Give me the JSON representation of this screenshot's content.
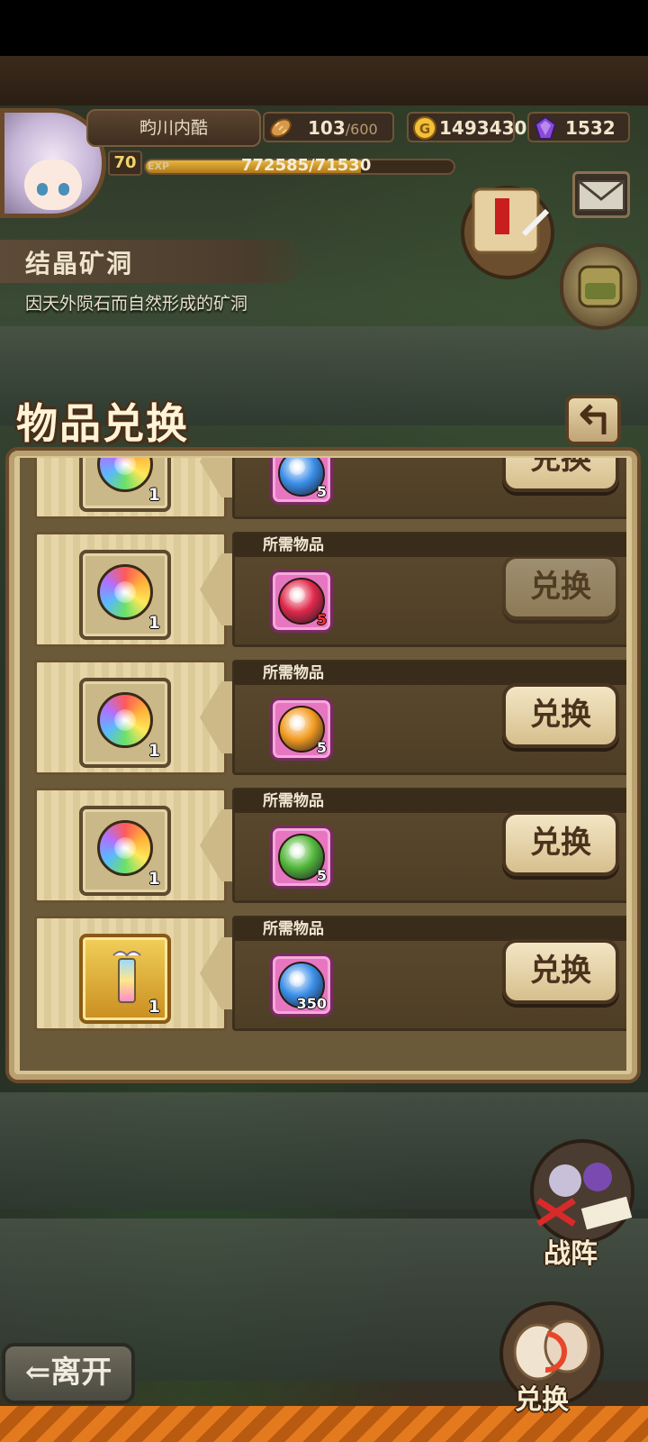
{
  "hud": {
    "player_name": "畇川内酷",
    "level": "70",
    "exp_tag": "EXP",
    "exp_text": "772585/71530",
    "exp_progress": 0.7,
    "stamina": {
      "icon": "bread-icon",
      "value": "103",
      "max": "/600"
    },
    "gold": {
      "icon": "gold-coin-icon",
      "value": "1493430"
    },
    "gems": {
      "icon": "purple-gem-icon",
      "value": "1532"
    }
  },
  "location": {
    "title": "结晶矿洞",
    "description": "因天外陨石而自然形成的矿洞"
  },
  "panel": {
    "title": "物品兑换",
    "back_icon": "return-arrow-icon",
    "required_label": "所需物品",
    "rows": [
      {
        "reward_icon": "rainbow-orb-icon",
        "reward_qty": "1",
        "req_icon": "blue-orb-icon",
        "req_color": "#3a8ee8",
        "req_qty": "5",
        "req_short": false,
        "button": "兑换",
        "enabled": true,
        "show_label": false
      },
      {
        "reward_icon": "rainbow-orb-icon",
        "reward_qty": "1",
        "req_icon": "red-orb-icon",
        "req_color": "#e0284a",
        "req_qty": "5",
        "req_short": true,
        "button": "兑换",
        "enabled": false,
        "show_label": true
      },
      {
        "reward_icon": "rainbow-orb-icon",
        "reward_qty": "1",
        "req_icon": "orange-orb-icon",
        "req_color": "#f29a1e",
        "req_qty": "5",
        "req_short": false,
        "button": "兑换",
        "enabled": true,
        "show_label": true
      },
      {
        "reward_icon": "rainbow-orb-icon",
        "reward_qty": "1",
        "req_icon": "green-orb-icon",
        "req_color": "#52b83a",
        "req_qty": "5",
        "req_short": false,
        "button": "兑换",
        "enabled": true,
        "show_label": true
      },
      {
        "reward_icon": "winged-lantern-icon",
        "reward_qty": "1",
        "req_icon": "blue-orb-icon",
        "req_color": "#3a8ee8",
        "req_qty": "350",
        "req_short": false,
        "button": "兑换",
        "enabled": true,
        "show_label": true
      }
    ]
  },
  "bottom": {
    "formation_label": "战阵",
    "leave_label": "⇐离开",
    "exchange_label": "兑换"
  },
  "colors": {
    "accent_gold": "#e8b640",
    "short_red": "#ff3030",
    "panel_tan": "#d8c492",
    "frame_brown": "#6a4a2a"
  }
}
